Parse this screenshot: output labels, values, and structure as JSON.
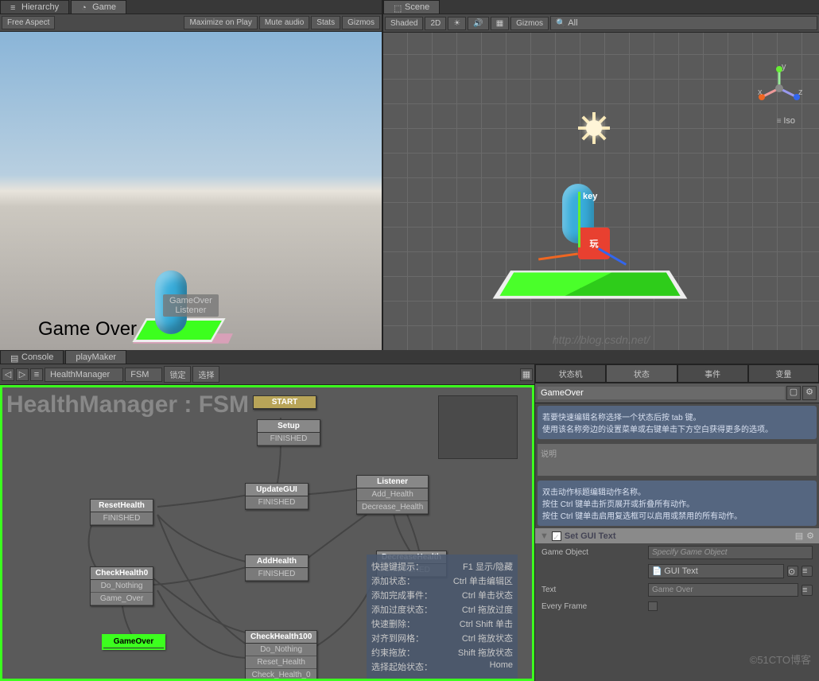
{
  "tabs": {
    "hierarchy": "Hierarchy",
    "game": "Game",
    "scene": "Scene",
    "console": "Console",
    "playmaker": "playMaker"
  },
  "gameToolbar": {
    "aspect": "Free Aspect",
    "maximize": "Maximize on Play",
    "mute": "Mute audio",
    "stats": "Stats",
    "gizmos": "Gizmos"
  },
  "sceneToolbar": {
    "shaded": "Shaded",
    "twod": "2D",
    "gizmos": "Gizmos",
    "search": "All"
  },
  "gameView": {
    "label1": "GameOver",
    "label2": "Listener",
    "overText": "Game Over"
  },
  "sceneView": {
    "keyLabel": "key",
    "iconText": "玩",
    "iso": "Iso",
    "axes": {
      "x": "x",
      "y": "y",
      "z": "z"
    }
  },
  "watermark": "http://blog.csdn.net/",
  "pmToolbar": {
    "obj": "HealthManager",
    "fsm": "FSM",
    "lock": "锁定",
    "select": "选择"
  },
  "pmTitle": "HealthManager : FSM",
  "states": {
    "start": "START",
    "setup": {
      "name": "Setup",
      "row": "FINISHED"
    },
    "updateGui": {
      "name": "UpdateGUI",
      "row": "FINISHED"
    },
    "listener": {
      "name": "Listener",
      "row1": "Add_Health",
      "row2": "Decrease_Health"
    },
    "resetHealth": {
      "name": "ResetHealth",
      "row": "FINISHED"
    },
    "addHealth": {
      "name": "AddHealth",
      "row": "FINISHED"
    },
    "decreaseHealth": {
      "name": "DecreaseHealth",
      "row": "FINISHED"
    },
    "checkHealth0": {
      "name": "CheckHealth0",
      "row1": "Do_Nothing",
      "row2": "Game_Over"
    },
    "checkHealth100": {
      "name": "CheckHealth100",
      "row1": "Do_Nothing",
      "row2": "Reset_Health",
      "row3": "Check_Health_0"
    },
    "gameOver": {
      "name": "GameOver"
    }
  },
  "shortcuts": [
    {
      "k": "快捷键提示：",
      "v": "F1 显示/隐藏"
    },
    {
      "k": "添加状态：",
      "v": "Ctrl 单击编辑区"
    },
    {
      "k": "添加完成事件：",
      "v": "Ctrl 单击状态"
    },
    {
      "k": "添加过度状态：",
      "v": "Ctrl 拖放过度"
    },
    {
      "k": "快速删除：",
      "v": "Ctrl Shift 单击"
    },
    {
      "k": "对齐到网格：",
      "v": "Ctrl 拖放状态"
    },
    {
      "k": "约束拖放：",
      "v": "Shift 拖放状态"
    },
    {
      "k": "选择起始状态：",
      "v": "Home"
    }
  ],
  "inspector": {
    "tabs": {
      "fsm": "状态机",
      "state": "状态",
      "event": "事件",
      "var": "变量"
    },
    "stateName": "GameOver",
    "hint1": "若要快速编辑名称选择一个状态后按 tab 键。\n使用该名称旁边的设置菜单或右键单击下方空白获得更多的选项。",
    "descPlaceholder": "说明",
    "hint2": "双击动作标题编辑动作名称。\n按住 Ctrl 键单击折页展开或折叠所有动作。\n按住 Ctrl 键单击启用复选框可以启用或禁用的所有动作。",
    "action": {
      "title": "Set GUI Text",
      "gameObject": "Game Object",
      "gameObjectVal": "Specify Game Object",
      "guiText": "GUI Text",
      "text": "Text",
      "textVal": "Game Over",
      "every": "Every Frame"
    }
  },
  "blogWm": "©51CTO博客"
}
